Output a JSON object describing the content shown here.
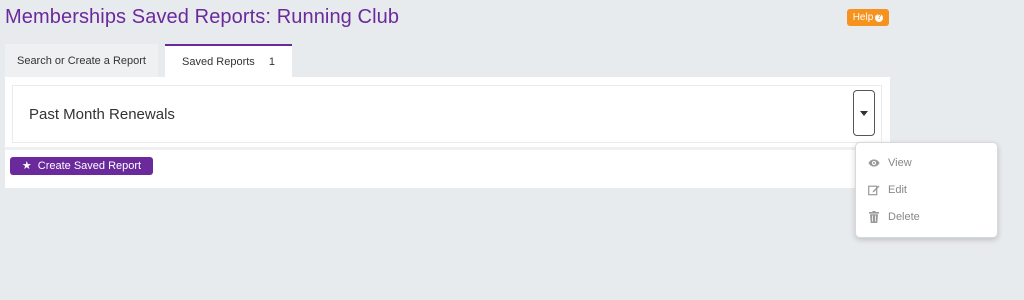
{
  "header": {
    "title": "Memberships Saved Reports: Running Club",
    "help_label": "Help",
    "help_icon": "question-circle-icon"
  },
  "tabs": [
    {
      "label": "Search or Create a Report",
      "active": false
    },
    {
      "label": "Saved Reports",
      "count": "1",
      "active": true
    }
  ],
  "reports": [
    {
      "name": "Past Month Renewals"
    }
  ],
  "actions": {
    "create_label": "Create Saved Report",
    "create_icon": "star-icon"
  },
  "dropdown_menu": {
    "items": [
      {
        "label": "View",
        "icon": "eye-icon"
      },
      {
        "label": "Edit",
        "icon": "edit-icon"
      },
      {
        "label": "Delete",
        "icon": "trash-icon"
      }
    ]
  },
  "colors": {
    "brand_purple": "#6a2a9c",
    "help_orange": "#f6921e",
    "background": "#e8ebee"
  }
}
